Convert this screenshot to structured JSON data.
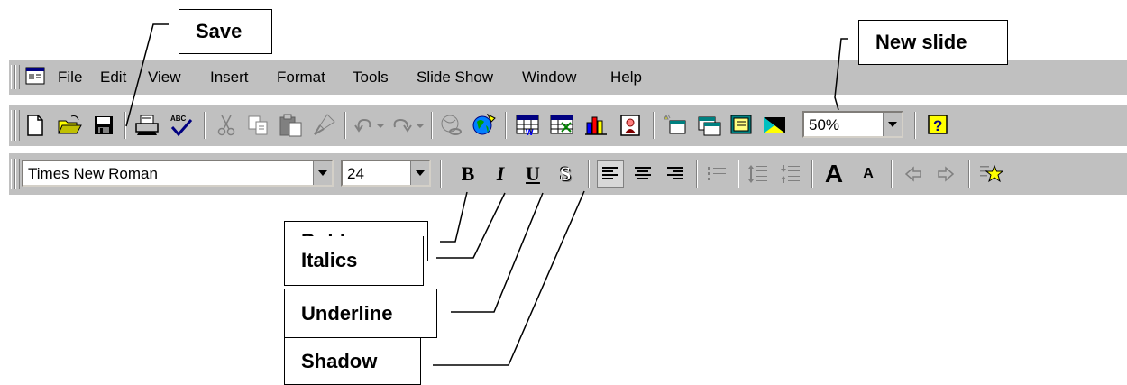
{
  "menubar": {
    "items": [
      "File",
      "Edit",
      "View",
      "Insert",
      "Format",
      "Tools",
      "Slide Show",
      "Window",
      "Help"
    ]
  },
  "standard_toolbar": {
    "icons": [
      "new-icon",
      "open-icon",
      "save-icon",
      "print-icon",
      "spelling-icon",
      "cut-icon",
      "copy-icon",
      "paste-icon",
      "format-painter-icon",
      "undo-icon",
      "redo-icon",
      "insert-hyperlink-icon",
      "web-toolbar-icon",
      "insert-word-table-icon",
      "insert-excel-worksheet-icon",
      "insert-chart-icon",
      "insert-clip-art-icon",
      "new-slide-icon",
      "slide-layout-icon",
      "apply-design-icon",
      "grayscale-icon",
      "help-icon"
    ],
    "zoom": "50%"
  },
  "formatting_toolbar": {
    "font": "Times New Roman",
    "font_size": "24",
    "bold_glyph": "B",
    "italic_glyph": "I",
    "underline_glyph": "U",
    "shadow_glyph": "S",
    "increase_font_glyph": "A",
    "decrease_font_glyph": "A"
  },
  "callouts": {
    "save": "Save",
    "new_slide": "New slide",
    "bold": "Bold",
    "italics": "Italics",
    "underline": "Underline",
    "shadow": "Shadow"
  }
}
